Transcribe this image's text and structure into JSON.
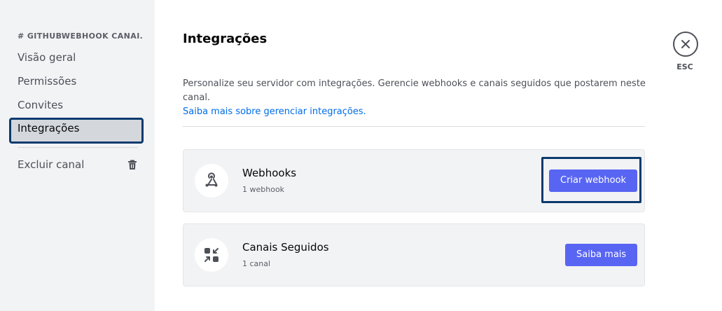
{
  "sidebar": {
    "channel_header": "# GITHUBWEBHOOK CANAI...",
    "items": [
      {
        "label": "Visão geral"
      },
      {
        "label": "Permissões"
      },
      {
        "label": "Convites"
      },
      {
        "label": "Integrações"
      }
    ],
    "danger_item": {
      "label": "Excluir canal",
      "icon": "trash-icon"
    },
    "active_item": "Integrações"
  },
  "main": {
    "title": "Integrações",
    "description": "Personalize seu servidor com integrações. Gerencie webhooks e canais seguidos que postarem neste canal.",
    "learn_link": "Saiba mais sobre gerenciar integrações.",
    "cards": [
      {
        "title": "Webhooks",
        "subtitle": "1 webhook",
        "button": "Criar webhook",
        "icon": "webhook-icon"
      },
      {
        "title": "Canais Seguidos",
        "subtitle": "1 canal",
        "button": "Saiba mais",
        "icon": "follow-channel-icon"
      }
    ]
  },
  "close": {
    "label": "ESC",
    "icon": "close-icon"
  },
  "colors": {
    "accent": "#5865f2",
    "link": "#006ce7",
    "focus_outline": "#0b3a6e",
    "sidebar_bg": "#f2f3f5"
  }
}
